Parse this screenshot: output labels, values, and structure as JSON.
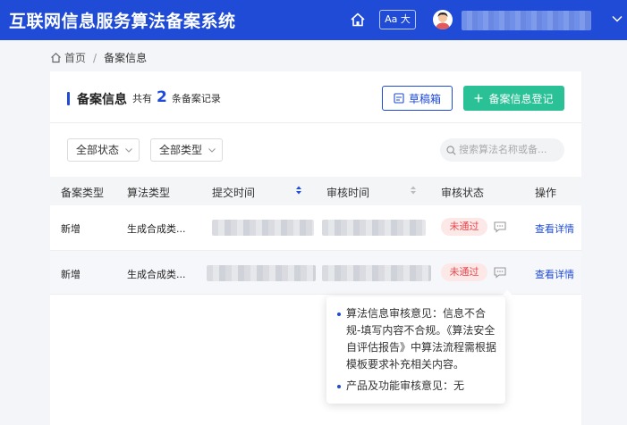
{
  "header": {
    "app_title": "互联网信息服务算法备案系统",
    "font_button_label": "Aa 大"
  },
  "breadcrumb": {
    "home": "首页",
    "separator": "/",
    "current": "备案信息"
  },
  "panel": {
    "title": "备案信息",
    "count_prefix": "共有",
    "count": "2",
    "count_suffix": "条备案记录",
    "draft_button": "草稿箱",
    "add_button": "备案信息登记"
  },
  "filters": {
    "status_select": "全部状态",
    "type_select": "全部类型",
    "search_placeholder": "搜索算法名称或备..."
  },
  "table": {
    "headers": [
      "备案类型",
      "算法类型",
      "提交时间",
      "审核时间",
      "审核状态",
      "操作"
    ],
    "rows": [
      {
        "filing_type": "新增",
        "algorithm_type": "生成合成类...",
        "status": "未通过",
        "action": "查看详情"
      },
      {
        "filing_type": "新增",
        "algorithm_type": "生成合成类...",
        "status": "未通过",
        "action": "查看详情"
      }
    ]
  },
  "tooltip": {
    "items": [
      "算法信息审核意见：信息不合规-填写内容不合规。《算法安全自评估报告》中算法流程需根据模板要求补充相关内容。",
      "产品及功能审核意见：无"
    ]
  },
  "colors": {
    "brand_blue": "#1f4bd6",
    "accent_green": "#2bc197",
    "reject_red": "#e5484d"
  }
}
